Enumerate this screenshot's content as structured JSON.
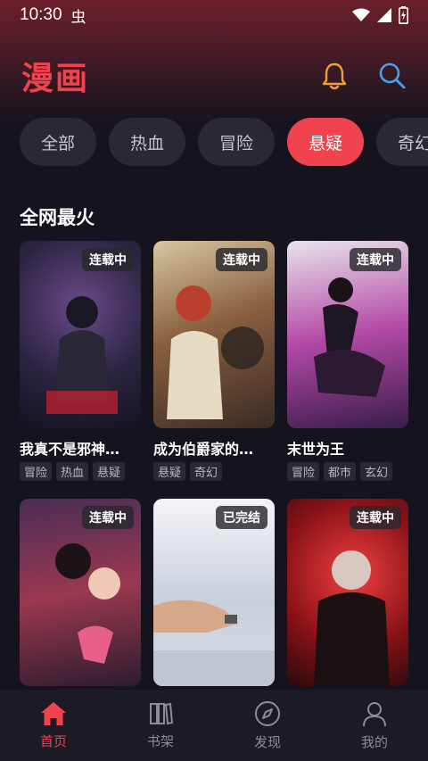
{
  "status_bar": {
    "time": "10:30",
    "notification": "虫"
  },
  "header": {
    "title": "漫画"
  },
  "colors": {
    "accent": "#f0434f",
    "bell": "#f0a030",
    "search": "#4aa0e8",
    "background": "#15131d"
  },
  "categories": [
    {
      "label": "全部"
    },
    {
      "label": "热血"
    },
    {
      "label": "冒险"
    },
    {
      "label": "悬疑",
      "active": true
    },
    {
      "label": "奇幻"
    }
  ],
  "section": {
    "title": "全网最火"
  },
  "comics": [
    {
      "title": "我真不是邪神…",
      "status": "连载中",
      "tags": [
        "冒险",
        "热血",
        "悬疑"
      ]
    },
    {
      "title": "成为伯爵家的…",
      "status": "连载中",
      "tags": [
        "悬疑",
        "奇幻"
      ]
    },
    {
      "title": "末世为王",
      "status": "连载中",
      "tags": [
        "冒险",
        "都市",
        "玄幻"
      ]
    },
    {
      "title": "",
      "status": "连载中",
      "tags": []
    },
    {
      "title": "",
      "status": "已完结",
      "tags": []
    },
    {
      "title": "",
      "status": "连载中",
      "tags": []
    }
  ],
  "nav": [
    {
      "label": "首页",
      "icon": "home-icon",
      "active": true
    },
    {
      "label": "书架",
      "icon": "bookshelf-icon"
    },
    {
      "label": "发现",
      "icon": "compass-icon"
    },
    {
      "label": "我的",
      "icon": "user-icon"
    }
  ]
}
